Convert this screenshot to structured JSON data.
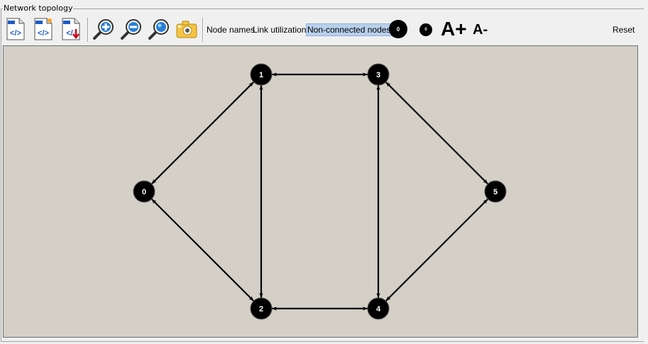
{
  "panel": {
    "title": "Network topology"
  },
  "toolbar": {
    "icons": [
      "load-design-icon",
      "load-traffic-icon",
      "save-design-icon",
      "zoom-in-icon",
      "zoom-out-icon",
      "zoom-all-icon",
      "screenshot-icon"
    ],
    "node_names": "Node names",
    "link_utilizations": "Link utilizations",
    "non_connected_nodes": "Non-connected nodes",
    "node_size_up": "0",
    "node_size_down": "0",
    "font_up": "A+",
    "font_down": "A-",
    "reset": "Reset"
  },
  "graph": {
    "nodes": [
      {
        "id": "0",
        "label": "0"
      },
      {
        "id": "1",
        "label": "1"
      },
      {
        "id": "2",
        "label": "2"
      },
      {
        "id": "3",
        "label": "3"
      },
      {
        "id": "4",
        "label": "4"
      },
      {
        "id": "5",
        "label": "5"
      }
    ],
    "links": [
      [
        "0",
        "1"
      ],
      [
        "0",
        "2"
      ],
      [
        "1",
        "2"
      ],
      [
        "1",
        "3"
      ],
      [
        "2",
        "4"
      ],
      [
        "3",
        "4"
      ],
      [
        "3",
        "5"
      ],
      [
        "4",
        "5"
      ]
    ],
    "colors": {
      "canvas_bg": "#d4d0c8",
      "node_fill": "#000000",
      "node_text": "#ffffff",
      "link": "#000000"
    }
  }
}
